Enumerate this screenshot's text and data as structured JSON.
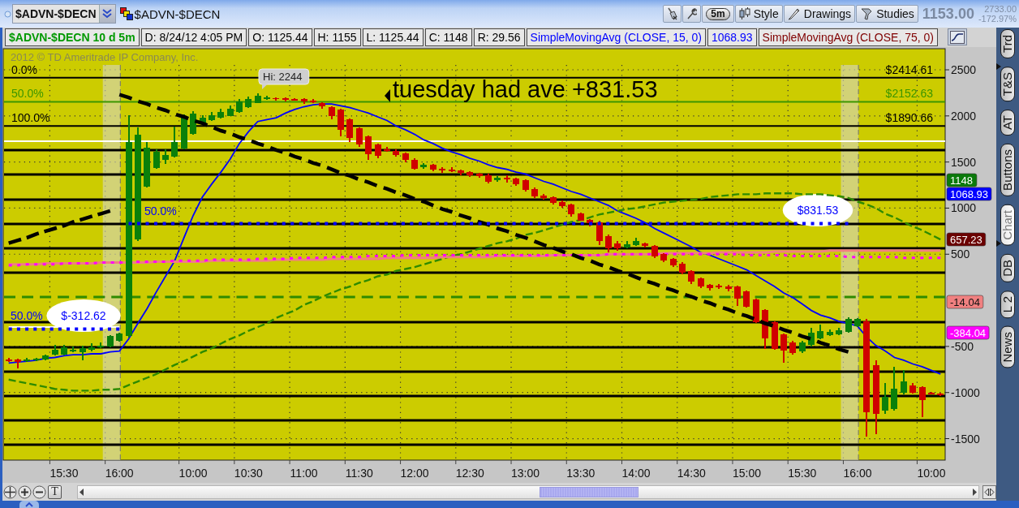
{
  "toolbar": {
    "symbol_field": {
      "value": "$ADVN-$DECN"
    },
    "linked_symbol": "$ADVN-$DECN",
    "buttons": [
      {
        "kind": "pill",
        "label": "5m"
      },
      {
        "kind": "menu",
        "label": "Style"
      },
      {
        "kind": "menu",
        "label": "Drawings"
      },
      {
        "kind": "menu",
        "label": "Studies"
      }
    ],
    "quote": {
      "price": "1153.00",
      "sub_values": [
        "2733.00",
        "-172.97%"
      ]
    }
  },
  "header": {
    "cells": [
      {
        "kind": "symbol",
        "text": "$ADVN-$DECN 10 d 5m",
        "color": "#009900"
      },
      {
        "kind": "plain",
        "text": "D: 8/24/12 4:05 PM",
        "color": "#000000"
      },
      {
        "kind": "plain",
        "text": "O: 1125.44",
        "color": "#000000"
      },
      {
        "kind": "plain",
        "text": "H: 1155",
        "color": "#000000"
      },
      {
        "kind": "plain",
        "text": "L: 1125.44",
        "color": "#000000"
      },
      {
        "kind": "plain",
        "text": "C: 1148",
        "color": "#000000"
      },
      {
        "kind": "plain",
        "text": "R: 29.56",
        "color": "#000000"
      },
      {
        "kind": "plain",
        "text": "SimpleMovingAvg (CLOSE, 15, 0)",
        "color": "#0000ff"
      },
      {
        "kind": "plain",
        "text": "1068.93",
        "color": "#0000ff"
      },
      {
        "kind": "plain",
        "text": "SimpleMovingAvg (CLOSE, 75, 0)",
        "color": "#800000"
      }
    ]
  },
  "chart": {
    "copyright": "2012 © TD Ameritrade IP Company, Inc.",
    "fib_labels": [
      {
        "text": "0.0%",
        "color": "#000000"
      },
      {
        "text": "50.0%",
        "color": "#3c9600"
      },
      {
        "text": "100.0%",
        "color": "#000000"
      }
    ],
    "level_labels": [
      "50.0%",
      "50.0%"
    ],
    "callout": "Hi: 2244",
    "headline": "tuesday had ave +831.53",
    "price_tags": [
      {
        "text": "1148",
        "color": "#0b7a0b"
      },
      {
        "text": "1068.93",
        "color": "#0000ff"
      },
      {
        "text": "657.23",
        "color": "#6b0000"
      },
      {
        "text": "-14.04",
        "color": "#f08080"
      },
      {
        "text": "-384.04",
        "color": "#ff00ff"
      }
    ],
    "chart_data": {
      "type": "line",
      "categories": [
        null,
        null,
        null,
        null,
        null,
        null,
        "15:30",
        null,
        null,
        null,
        null,
        null,
        "16:00",
        null,
        null,
        null,
        null,
        null,
        null,
        null,
        "10:00",
        null,
        null,
        null,
        null,
        null,
        "10:30",
        null,
        null,
        null,
        null,
        null,
        "11:00",
        null,
        null,
        null,
        null,
        null,
        "11:30",
        null,
        null,
        null,
        null,
        null,
        "12:00",
        null,
        null,
        null,
        null,
        null,
        "12:30",
        null,
        null,
        null,
        null,
        null,
        "13:00",
        null,
        null,
        null,
        null,
        null,
        "13:30",
        null,
        null,
        null,
        null,
        null,
        "14:00",
        null,
        null,
        null,
        null,
        null,
        "14:30",
        null,
        null,
        null,
        null,
        null,
        "15:00",
        null,
        null,
        null,
        null,
        null,
        "15:30",
        null,
        null,
        null,
        null,
        null,
        "16:00",
        null,
        null,
        null,
        null,
        null,
        null,
        null,
        "10:00",
        null
      ],
      "series": [
        {
          "type": "candlestick",
          "ohlc": [
            [
              -640,
              -620,
              -665,
              -650
            ],
            [
              -640,
              -630,
              -740,
              -670
            ],
            [
              -650,
              -625,
              -670,
              -640
            ],
            [
              -650,
              -620,
              -660,
              -630
            ],
            [
              -640,
              -590,
              -650,
              -600
            ],
            [
              -590,
              -480,
              -600,
              -540
            ],
            [
              -590,
              -480,
              -600,
              -510
            ],
            [
              -550,
              -500,
              -560,
              -535
            ],
            [
              -560,
              -490,
              -650,
              -520
            ],
            [
              -540,
              -470,
              -550,
              -510
            ],
            [
              -510,
              -460,
              -520,
              -490
            ],
            [
              -500,
              -380,
              -510,
              -390
            ],
            [
              -440,
              -350,
              -450,
              -360
            ],
            [
              -390,
              2010,
              -400,
              1720
            ],
            [
              660,
              1875,
              640,
              1800
            ],
            [
              1232,
              1717,
              1225,
              1655
            ],
            [
              1435,
              1640,
              1430,
              1610
            ],
            [
              1520,
              1640,
              1480,
              1575
            ],
            [
              1560,
              1880,
              1550,
              1717
            ],
            [
              1646,
              2020,
              1640,
              1980
            ],
            [
              1805,
              2050,
              1800,
              2025
            ],
            [
              1910,
              2010,
              1900,
              1980
            ],
            [
              1955,
              2040,
              1950,
              2005
            ],
            [
              1980,
              2080,
              1975,
              2040
            ],
            [
              2000,
              2110,
              1995,
              2075
            ],
            [
              2040,
              2180,
              2035,
              2155
            ],
            [
              2095,
              2210,
              2090,
              2180
            ],
            [
              2140,
              2244,
              2135,
              2215
            ],
            [
              2180,
              2220,
              2175,
              2205
            ],
            [
              2195,
              2205,
              2170,
              2185
            ],
            [
              2190,
              2200,
              2160,
              2172
            ],
            [
              2185,
              2195,
              2165,
              2175
            ],
            [
              2180,
              2190,
              2130,
              2160
            ],
            [
              2170,
              2180,
              2140,
              2150
            ],
            [
              2140,
              2150,
              2080,
              2100
            ],
            [
              2095,
              2105,
              1960,
              2000
            ],
            [
              2070,
              2080,
              1780,
              1850
            ],
            [
              1960,
              1970,
              1720,
              1760
            ],
            [
              1865,
              1875,
              1660,
              1690
            ],
            [
              1780,
              1790,
              1520,
              1585
            ],
            [
              1690,
              1700,
              1540,
              1570
            ],
            [
              1640,
              1660,
              1610,
              1630
            ],
            [
              1620,
              1640,
              1560,
              1580
            ],
            [
              1590,
              1600,
              1500,
              1520
            ],
            [
              1520,
              1540,
              1420,
              1430
            ],
            [
              1440,
              1490,
              1430,
              1470
            ],
            [
              1470,
              1480,
              1400,
              1420
            ],
            [
              1430,
              1440,
              1380,
              1410
            ],
            [
              1420,
              1440,
              1390,
              1400
            ],
            [
              1410,
              1420,
              1360,
              1380
            ],
            [
              1390,
              1400,
              1340,
              1360
            ],
            [
              1370,
              1380,
              1330,
              1350
            ],
            [
              1360,
              1370,
              1270,
              1290
            ],
            [
              1300,
              1345,
              1290,
              1330
            ],
            [
              1330,
              1355,
              1280,
              1320
            ],
            [
              1320,
              1330,
              1240,
              1260
            ],
            [
              1300,
              1310,
              1180,
              1200
            ],
            [
              1210,
              1220,
              1110,
              1130
            ],
            [
              1140,
              1150,
              1090,
              1110
            ],
            [
              1120,
              1130,
              1040,
              1060
            ],
            [
              1070,
              1080,
              1000,
              1020
            ],
            [
              1040,
              1050,
              910,
              930
            ],
            [
              940,
              950,
              860,
              860
            ],
            [
              870,
              880,
              800,
              840
            ],
            [
              850,
              860,
              600,
              640
            ],
            [
              700,
              710,
              520,
              560
            ],
            [
              620,
              640,
              540,
              560
            ],
            [
              570,
              640,
              560,
              610
            ],
            [
              600,
              680,
              590,
              640
            ],
            [
              620,
              630,
              570,
              590
            ],
            [
              590,
              600,
              460,
              480
            ],
            [
              500,
              510,
              410,
              430
            ],
            [
              450,
              460,
              360,
              380
            ],
            [
              400,
              410,
              280,
              300
            ],
            [
              320,
              330,
              180,
              200
            ],
            [
              240,
              250,
              130,
              150
            ],
            [
              170,
              180,
              110,
              130
            ],
            [
              160,
              180,
              120,
              150
            ],
            [
              150,
              170,
              100,
              120
            ],
            [
              150,
              160,
              -60,
              20
            ],
            [
              95,
              105,
              -80,
              -70
            ],
            [
              10,
              20,
              -250,
              -240
            ],
            [
              -105,
              -95,
              -530,
              -415
            ],
            [
              -238,
              -230,
              -540,
              -528
            ],
            [
              -370,
              -360,
              -680,
              -546
            ],
            [
              -458,
              -440,
              -590,
              -572
            ],
            [
              -555,
              -440,
              -570,
              -458
            ],
            [
              -484,
              -300,
              -500,
              -352
            ],
            [
              -414,
              -264,
              -420,
              -334
            ],
            [
              -378,
              -320,
              -390,
              -343
            ],
            [
              -370,
              -300,
              -380,
              -326
            ],
            [
              -343,
              -180,
              -350,
              -202
            ],
            [
              -282,
              -190,
              -290,
              -202
            ],
            [
              -230,
              -200,
              -1480,
              -1215
            ],
            [
              -700,
              -650,
              -1450,
              -1230
            ],
            [
              -1200,
              -900,
              -1230,
              -1050
            ],
            [
              -1180,
              -720,
              -1200,
              -960
            ],
            [
              -1000,
              -760,
              -1020,
              -880
            ],
            [
              -920,
              -900,
              -1010,
              -1000
            ],
            [
              -940,
              -930,
              -1270,
              -1080
            ],
            [
              -1000,
              -990,
              -1020,
              -1010
            ],
            [
              -1010,
              -1000,
              -1040,
              -1030
            ]
          ]
        },
        {
          "color": "#0000ff",
          "values": [
            -680,
            -670,
            -660,
            -650,
            -630,
            -620,
            -600,
            -590,
            -590,
            -580,
            -580,
            -560,
            -550,
            -420,
            -250,
            -90,
            90,
            260,
            430,
            680,
            920,
            1120,
            1260,
            1390,
            1530,
            1700,
            1830,
            1940,
            1960,
            1980,
            2030,
            2070,
            2100,
            2120,
            2130,
            2130,
            2110,
            2090,
            2060,
            2030,
            1990,
            1950,
            1890,
            1850,
            1800,
            1740,
            1700,
            1650,
            1610,
            1580,
            1540,
            1510,
            1470,
            1440,
            1420,
            1390,
            1370,
            1330,
            1290,
            1260,
            1220,
            1180,
            1150,
            1110,
            1070,
            1030,
            970,
            930,
            890,
            840,
            780,
            730,
            680,
            630,
            580,
            520,
            490,
            450,
            410,
            370,
            330,
            270,
            210,
            150,
            80,
            30,
            -40,
            -110,
            -160,
            -190,
            -230,
            -250,
            -280,
            -400,
            -490,
            -550,
            -620,
            -650,
            -690,
            -720,
            -760,
            -800
          ]
        },
        {
          "color": "#2e8b00",
          "line_style": "dashed",
          "values": [
            -860,
            -880,
            -900,
            -920,
            -940,
            -960,
            -970,
            -980,
            -980,
            -980,
            -970,
            -970,
            -960,
            -920,
            -880,
            -840,
            -800,
            -750,
            -700,
            -660,
            -610,
            -560,
            -520,
            -470,
            -420,
            -380,
            -330,
            -290,
            -250,
            -190,
            -150,
            -110,
            -50,
            -10,
            40,
            80,
            120,
            150,
            190,
            220,
            260,
            280,
            320,
            340,
            360,
            390,
            420,
            450,
            480,
            500,
            530,
            560,
            590,
            620,
            640,
            670,
            710,
            730,
            760,
            790,
            820,
            850,
            870,
            900,
            930,
            950,
            970,
            990,
            1000,
            1020,
            1040,
            1060,
            1070,
            1080,
            1090,
            1100,
            1120,
            1130,
            1140,
            1150,
            1150,
            1150,
            1160,
            1160,
            1160,
            1160,
            1150,
            1150,
            1150,
            1140,
            1130,
            1110,
            1070,
            1040,
            1000,
            940,
            900,
            850,
            800,
            760,
            710,
            660
          ]
        },
        {
          "color": "#f08080",
          "values": [
            390,
            390,
            390,
            390,
            400,
            400,
            400,
            400,
            400,
            400,
            410,
            410,
            410,
            410,
            410,
            410,
            420,
            420,
            420,
            420,
            420,
            420,
            430,
            430,
            430,
            430,
            430,
            430,
            430,
            440,
            440,
            440,
            440,
            440,
            440,
            450,
            450,
            450,
            450,
            450,
            450,
            460,
            460,
            460,
            460,
            460,
            460,
            470,
            470,
            470,
            470,
            470,
            470,
            480,
            480,
            480,
            480,
            480,
            480,
            490,
            490,
            490,
            490,
            490,
            490,
            500,
            500,
            500,
            500,
            500,
            500,
            510,
            510,
            510,
            510,
            510,
            510,
            520,
            520,
            520,
            520,
            520,
            520,
            530,
            530,
            530,
            530,
            530,
            530,
            540,
            540,
            540,
            540,
            540,
            540,
            540,
            540,
            540,
            540,
            540,
            540,
            540
          ]
        },
        {
          "color": "#ff00ff",
          "line_style": "dotted",
          "values": [
            380,
            380,
            390,
            390,
            390,
            390,
            400,
            400,
            400,
            400,
            410,
            410,
            410,
            410,
            420,
            420,
            420,
            420,
            430,
            430,
            430,
            430,
            440,
            440,
            440,
            440,
            440,
            450,
            450,
            450,
            450,
            460,
            460,
            460,
            460,
            470,
            470,
            470,
            470,
            480,
            480,
            480,
            480,
            490,
            490,
            490,
            490,
            490,
            490,
            490,
            490,
            490,
            490,
            490,
            490,
            490,
            490,
            490,
            490,
            490,
            490,
            490,
            490,
            490,
            490,
            500,
            500,
            500,
            500,
            500,
            500,
            500,
            500,
            500,
            500,
            500,
            500,
            500,
            500,
            500,
            490,
            490,
            490,
            490,
            490,
            480,
            480,
            480,
            480,
            480,
            480,
            470,
            470,
            470,
            470,
            470,
            470,
            460,
            460,
            460,
            460,
            460
          ]
        },
        {
          "color": "#ffffff",
          "values": [
            -290,
            -290,
            -290,
            -290,
            -290,
            -290,
            -290,
            -290,
            -290,
            -290,
            -290,
            -290,
            -290,
            null,
            null,
            null,
            null,
            null,
            null,
            null,
            null,
            null,
            null,
            null,
            null,
            null,
            null,
            null,
            null,
            null,
            null,
            null,
            null,
            null,
            null,
            null,
            null,
            null,
            null,
            null,
            null,
            null,
            null,
            null,
            null,
            null,
            null,
            null,
            null,
            null,
            null,
            null,
            null,
            null,
            null,
            null,
            null,
            null,
            null,
            null,
            null,
            null,
            null,
            null,
            null,
            null,
            null,
            null,
            null,
            null,
            null,
            null,
            null,
            null,
            null,
            null,
            null,
            null,
            null,
            null,
            null,
            null,
            null,
            null,
            null,
            null,
            null,
            null,
            null,
            null,
            null,
            null,
            null,
            null,
            null,
            null,
            null,
            null,
            null,
            null,
            null,
            null
          ]
        },
        {
          "color": "#000000",
          "line_style": "dashed",
          "values": [
            620,
            650,
            680,
            720,
            750,
            780,
            810,
            850,
            880,
            910,
            940,
            970,
            null,
            null,
            null,
            null,
            null,
            null,
            null,
            null,
            null,
            null,
            null,
            null,
            null,
            null,
            null,
            null,
            null,
            null,
            null,
            null,
            null,
            null,
            null,
            null,
            null,
            null,
            null,
            null,
            null,
            null,
            null,
            null,
            null,
            null,
            null,
            null,
            null,
            null,
            null,
            null,
            null,
            null,
            null,
            null,
            null,
            null,
            null,
            null,
            null,
            null,
            null,
            null,
            null,
            null,
            null,
            null,
            null,
            null,
            null,
            null,
            null,
            null,
            null,
            null,
            null,
            null,
            null,
            null,
            null,
            null,
            null,
            null,
            null,
            null,
            null,
            null,
            null,
            null,
            null,
            null,
            null,
            null,
            null,
            null,
            null,
            null,
            null,
            null,
            null,
            null
          ]
        },
        {
          "color": "#000000",
          "line_style": "dashed",
          "values": [
            null,
            null,
            null,
            null,
            null,
            null,
            null,
            null,
            null,
            null,
            null,
            null,
            2230,
            2200,
            2160,
            2130,
            2090,
            2060,
            2020,
            1990,
            1950,
            1920,
            1880,
            1840,
            1810,
            1770,
            1740,
            1700,
            1670,
            1630,
            1600,
            1560,
            1530,
            1490,
            1460,
            1420,
            1380,
            1350,
            1310,
            1280,
            1240,
            1210,
            1170,
            1140,
            1100,
            1070,
            1030,
            990,
            960,
            920,
            890,
            850,
            820,
            780,
            750,
            710,
            680,
            640,
            600,
            570,
            530,
            500,
            460,
            430,
            390,
            360,
            320,
            290,
            250,
            210,
            180,
            140,
            110,
            70,
            40,
            0,
            -30,
            -70,
            -100,
            -140,
            -170,
            -210,
            -250,
            -280,
            -320,
            -350,
            -390,
            -420,
            -460,
            -490,
            -530,
            -560,
            null,
            null,
            null,
            null,
            null,
            null,
            null,
            null,
            null,
            null
          ]
        },
        {
          "name": "$-312.62",
          "color": "#0000ff",
          "line_style": "dotted",
          "values": [
            -312.62,
            -312.62,
            -312.62,
            -312.62,
            -312.62,
            -312.62,
            -312.62,
            -312.62,
            -312.62,
            -312.62,
            -312.62,
            -312.62,
            -312.62,
            null,
            null,
            null,
            null,
            null,
            null,
            null,
            null,
            null,
            null,
            null,
            null,
            null,
            null,
            null,
            null,
            null,
            null,
            null,
            null,
            null,
            null,
            null,
            null,
            null,
            null,
            null,
            null,
            null,
            null,
            null,
            null,
            null,
            null,
            null,
            null,
            null,
            null,
            null,
            null,
            null,
            null,
            null,
            null,
            null,
            null,
            null,
            null,
            null,
            null,
            null,
            null,
            null,
            null,
            null,
            null,
            null,
            null,
            null,
            null,
            null,
            null,
            null,
            null,
            null,
            null,
            null,
            null,
            null,
            null,
            null,
            null,
            null,
            null,
            null,
            null,
            null,
            null,
            null,
            null,
            null,
            null,
            null,
            null,
            null,
            null,
            null,
            null,
            null
          ]
        },
        {
          "name": "$831.53",
          "color": "#0000ff",
          "line_style": "dotted",
          "values": [
            null,
            null,
            null,
            null,
            null,
            null,
            null,
            null,
            null,
            null,
            null,
            null,
            null,
            831.53,
            831.53,
            831.53,
            831.53,
            831.53,
            831.53,
            831.53,
            831.53,
            831.53,
            831.53,
            831.53,
            831.53,
            831.53,
            831.53,
            831.53,
            831.53,
            831.53,
            831.53,
            831.53,
            831.53,
            831.53,
            831.53,
            831.53,
            831.53,
            831.53,
            831.53,
            831.53,
            831.53,
            831.53,
            831.53,
            831.53,
            831.53,
            831.53,
            831.53,
            831.53,
            831.53,
            831.53,
            831.53,
            831.53,
            831.53,
            831.53,
            831.53,
            831.53,
            831.53,
            831.53,
            831.53,
            831.53,
            831.53,
            831.53,
            831.53,
            831.53,
            831.53,
            831.53,
            831.53,
            831.53,
            831.53,
            831.53,
            831.53,
            831.53,
            831.53,
            831.53,
            831.53,
            831.53,
            831.53,
            831.53,
            831.53,
            831.53,
            831.53,
            831.53,
            831.53,
            831.53,
            831.53,
            831.53,
            831.53,
            831.53,
            831.53,
            831.53,
            831.53,
            831.53,
            null,
            null,
            null,
            null,
            null,
            null,
            null,
            null,
            null,
            null
          ]
        }
      ],
      "ylim": [
        -1733,
        2729
      ],
      "yticks": [
        2500,
        2000,
        1500,
        1000,
        500,
        -500,
        -1000,
        -1500
      ],
      "grid": true,
      "ref_lines": [
        {
          "axis": "y",
          "value": 2414.61,
          "label": "$2414.61",
          "color": "#000000"
        },
        {
          "axis": "y",
          "value": 2152.63,
          "label": "$2152.63",
          "color": "#3c9600"
        },
        {
          "axis": "y",
          "value": 1890.66,
          "label": "$1890.66",
          "color": "#000000"
        },
        {
          "axis": "y",
          "value": 1726,
          "color": "#ffffff"
        },
        {
          "axis": "y",
          "value": 1629,
          "color": "#000000"
        },
        {
          "axis": "y",
          "value": 1365,
          "color": "#000000"
        },
        {
          "axis": "y",
          "value": 1092,
          "color": "#000000"
        },
        {
          "axis": "y",
          "value": 828,
          "color": "#000000"
        },
        {
          "axis": "y",
          "value": 564,
          "color": "#000000"
        },
        {
          "axis": "y",
          "value": 300,
          "color": "#000000"
        },
        {
          "axis": "y",
          "value": 36,
          "color": "#2e8b00",
          "line_style": "dashed"
        },
        {
          "axis": "y",
          "value": -237,
          "color": "#000000"
        },
        {
          "axis": "y",
          "value": -510,
          "color": "#000000"
        },
        {
          "axis": "y",
          "value": -774,
          "color": "#000000"
        },
        {
          "axis": "y",
          "value": -1038,
          "color": "#000000"
        },
        {
          "axis": "y",
          "value": -1302,
          "color": "#000000"
        },
        {
          "axis": "y",
          "value": -1566,
          "color": "#000000"
        }
      ]
    }
  },
  "controls": {
    "text_tool_label": "T"
  },
  "side_tabs": [
    {
      "label": "Trd",
      "selected": false
    },
    {
      "label": "T&S",
      "selected": false
    },
    {
      "label": "AT",
      "selected": false
    },
    {
      "label": "Buttons",
      "selected": false
    },
    {
      "label": "Chart",
      "selected": true
    },
    {
      "label": "DB",
      "selected": false
    },
    {
      "label": "L 2",
      "selected": false
    },
    {
      "label": "News",
      "selected": false
    }
  ]
}
